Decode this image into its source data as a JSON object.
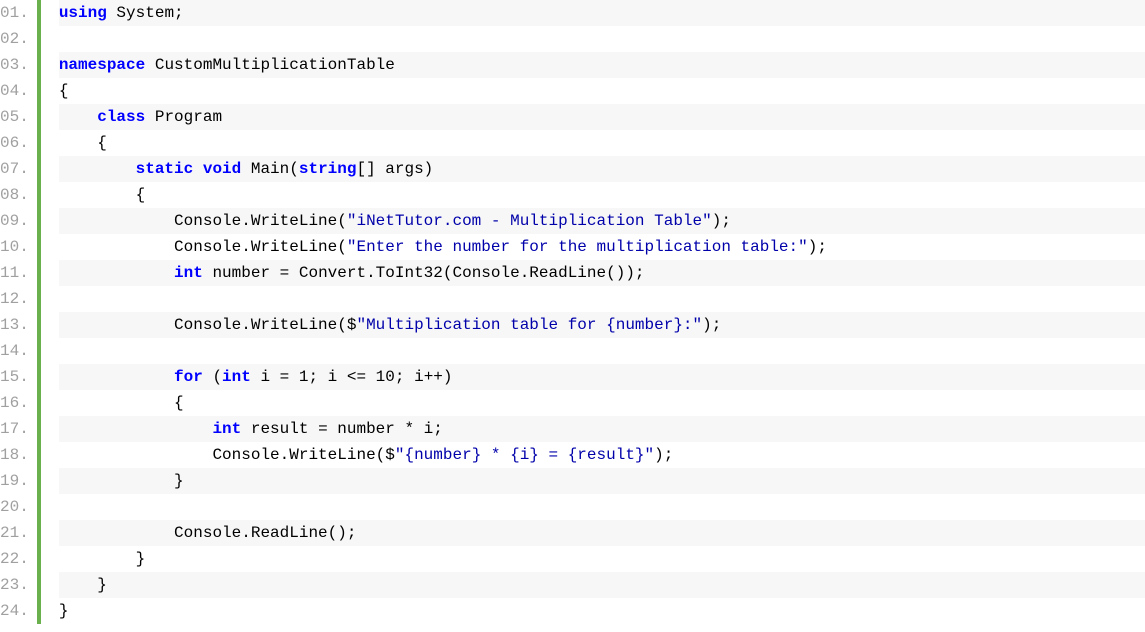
{
  "lines": [
    {
      "n": "01.",
      "segs": [
        {
          "c": "kw",
          "t": "using"
        },
        {
          "c": "plain",
          "t": " System;"
        }
      ]
    },
    {
      "n": "02.",
      "segs": [
        {
          "c": "plain",
          "t": ""
        }
      ]
    },
    {
      "n": "03.",
      "segs": [
        {
          "c": "kw",
          "t": "namespace"
        },
        {
          "c": "plain",
          "t": " CustomMultiplicationTable"
        }
      ]
    },
    {
      "n": "04.",
      "segs": [
        {
          "c": "plain",
          "t": "{"
        }
      ]
    },
    {
      "n": "05.",
      "segs": [
        {
          "c": "plain",
          "t": "    "
        },
        {
          "c": "kw",
          "t": "class"
        },
        {
          "c": "plain",
          "t": " Program"
        }
      ]
    },
    {
      "n": "06.",
      "segs": [
        {
          "c": "plain",
          "t": "    {"
        }
      ]
    },
    {
      "n": "07.",
      "segs": [
        {
          "c": "plain",
          "t": "        "
        },
        {
          "c": "kw",
          "t": "static"
        },
        {
          "c": "plain",
          "t": " "
        },
        {
          "c": "kw",
          "t": "void"
        },
        {
          "c": "plain",
          "t": " Main("
        },
        {
          "c": "kw",
          "t": "string"
        },
        {
          "c": "plain",
          "t": "[] args)"
        }
      ]
    },
    {
      "n": "08.",
      "segs": [
        {
          "c": "plain",
          "t": "        {"
        }
      ]
    },
    {
      "n": "09.",
      "segs": [
        {
          "c": "plain",
          "t": "            Console.WriteLine("
        },
        {
          "c": "str",
          "t": "\"iNetTutor.com - Multiplication Table\""
        },
        {
          "c": "plain",
          "t": ");"
        }
      ]
    },
    {
      "n": "10.",
      "segs": [
        {
          "c": "plain",
          "t": "            Console.WriteLine("
        },
        {
          "c": "str",
          "t": "\"Enter the number for the multiplication table:\""
        },
        {
          "c": "plain",
          "t": ");"
        }
      ]
    },
    {
      "n": "11.",
      "segs": [
        {
          "c": "plain",
          "t": "            "
        },
        {
          "c": "kw",
          "t": "int"
        },
        {
          "c": "plain",
          "t": " number = Convert.ToInt32(Console.ReadLine());"
        }
      ]
    },
    {
      "n": "12.",
      "segs": [
        {
          "c": "plain",
          "t": ""
        }
      ]
    },
    {
      "n": "13.",
      "segs": [
        {
          "c": "plain",
          "t": "            Console.WriteLine($"
        },
        {
          "c": "str",
          "t": "\"Multiplication table for {number}:\""
        },
        {
          "c": "plain",
          "t": ");"
        }
      ]
    },
    {
      "n": "14.",
      "segs": [
        {
          "c": "plain",
          "t": ""
        }
      ]
    },
    {
      "n": "15.",
      "segs": [
        {
          "c": "plain",
          "t": "            "
        },
        {
          "c": "kw",
          "t": "for"
        },
        {
          "c": "plain",
          "t": " ("
        },
        {
          "c": "kw",
          "t": "int"
        },
        {
          "c": "plain",
          "t": " i = 1; i <= 10; i++)"
        }
      ]
    },
    {
      "n": "16.",
      "segs": [
        {
          "c": "plain",
          "t": "            {"
        }
      ]
    },
    {
      "n": "17.",
      "segs": [
        {
          "c": "plain",
          "t": "                "
        },
        {
          "c": "kw",
          "t": "int"
        },
        {
          "c": "plain",
          "t": " result = number * i;"
        }
      ]
    },
    {
      "n": "18.",
      "segs": [
        {
          "c": "plain",
          "t": "                Console.WriteLine($"
        },
        {
          "c": "str",
          "t": "\"{number} * {i} = {result}\""
        },
        {
          "c": "plain",
          "t": ");"
        }
      ]
    },
    {
      "n": "19.",
      "segs": [
        {
          "c": "plain",
          "t": "            }"
        }
      ]
    },
    {
      "n": "20.",
      "segs": [
        {
          "c": "plain",
          "t": ""
        }
      ]
    },
    {
      "n": "21.",
      "segs": [
        {
          "c": "plain",
          "t": "            Console.ReadLine();"
        }
      ]
    },
    {
      "n": "22.",
      "segs": [
        {
          "c": "plain",
          "t": "        }"
        }
      ]
    },
    {
      "n": "23.",
      "segs": [
        {
          "c": "plain",
          "t": "    }"
        }
      ]
    },
    {
      "n": "24.",
      "segs": [
        {
          "c": "plain",
          "t": "}"
        }
      ]
    }
  ]
}
